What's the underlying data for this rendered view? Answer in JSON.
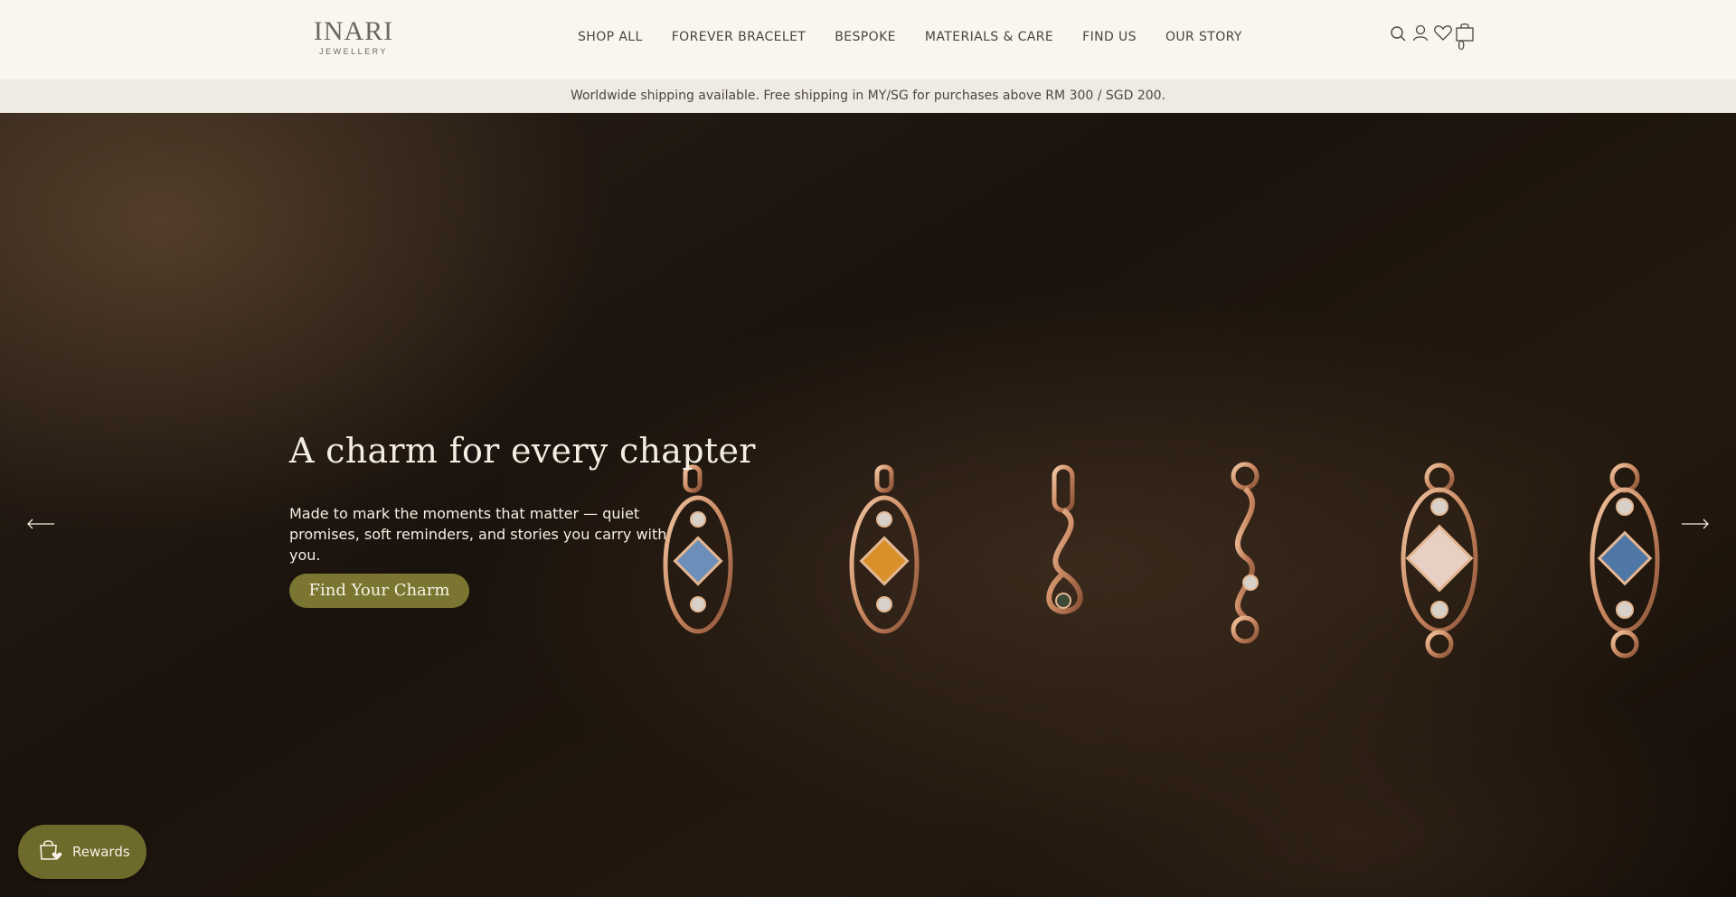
{
  "logo": {
    "main": "INARI",
    "sub": "JEWELLERY"
  },
  "nav": [
    {
      "label": "SHOP ALL"
    },
    {
      "label": "FOREVER BRACELET"
    },
    {
      "label": "BESPOKE"
    },
    {
      "label": "MATERIALS & CARE"
    },
    {
      "label": "FIND US"
    },
    {
      "label": "OUR STORY"
    }
  ],
  "header_icons": [
    "search-icon",
    "account-icon",
    "wishlist-heart-icon",
    "cart-bag-icon"
  ],
  "cart": {
    "count": "0"
  },
  "announcement": "Worldwide shipping available. Free shipping in MY/SG for purchases above RM 300 / SGD 200.",
  "hero": {
    "title": "A charm for every chapter",
    "subtitle": "Made to mark the moments that matter — quiet promises, soft reminders, and stories you carry with you.",
    "cta_label": "Find Your Charm",
    "prev_icon": "arrow-left-icon",
    "next_icon": "arrow-right-icon"
  },
  "rewards": {
    "label": "Rewards",
    "icon": "shopping-bag-heart-icon"
  },
  "colors": {
    "header_bg": "#f9f6f0",
    "announcement_bg": "#efebe2",
    "cta_bg": "#7a7631",
    "rewards_bg": "#6e6a2c",
    "gold": "#d9a27e"
  }
}
